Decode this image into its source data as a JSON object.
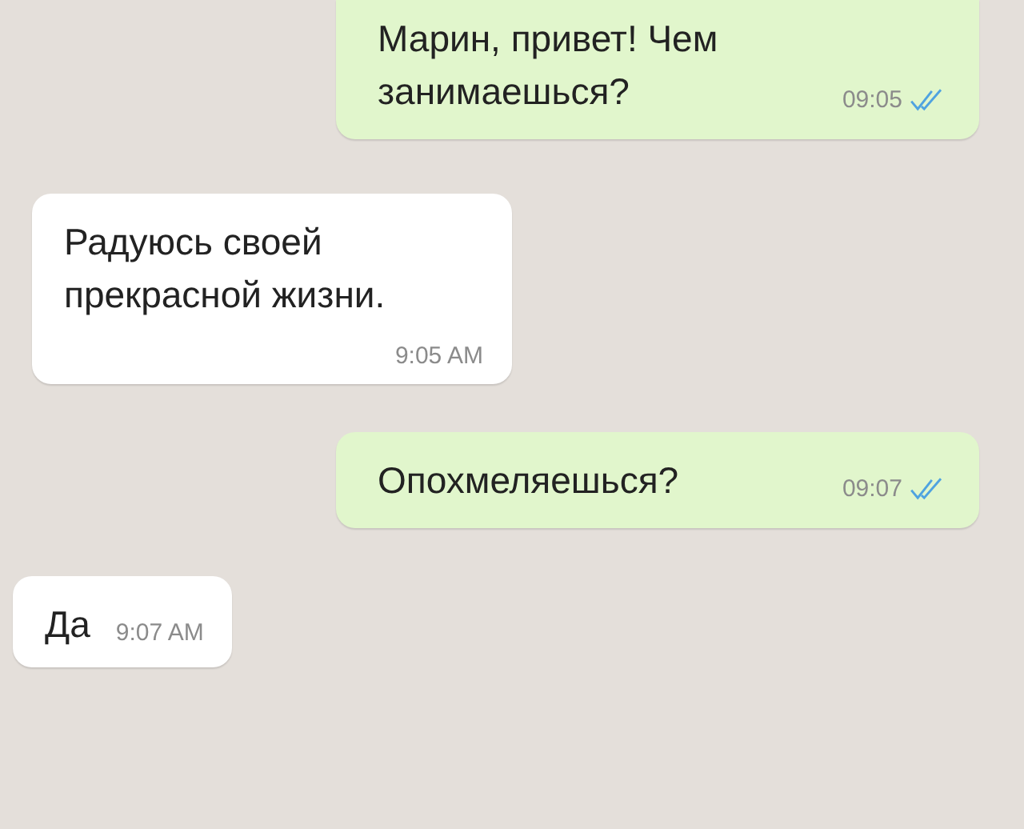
{
  "messages": [
    {
      "kind": "outgoing",
      "text": "Марин, привет! Чем занимаешься?",
      "time": "09:05",
      "read": true
    },
    {
      "kind": "incoming",
      "text": "Радуюсь своей прекрасной жизни.",
      "time": "9:05 AM"
    },
    {
      "kind": "outgoing",
      "text": "Опохмеляешься?",
      "time": "09:07",
      "read": true
    },
    {
      "kind": "incoming",
      "text": "Да",
      "time": "9:07 AM"
    }
  ]
}
